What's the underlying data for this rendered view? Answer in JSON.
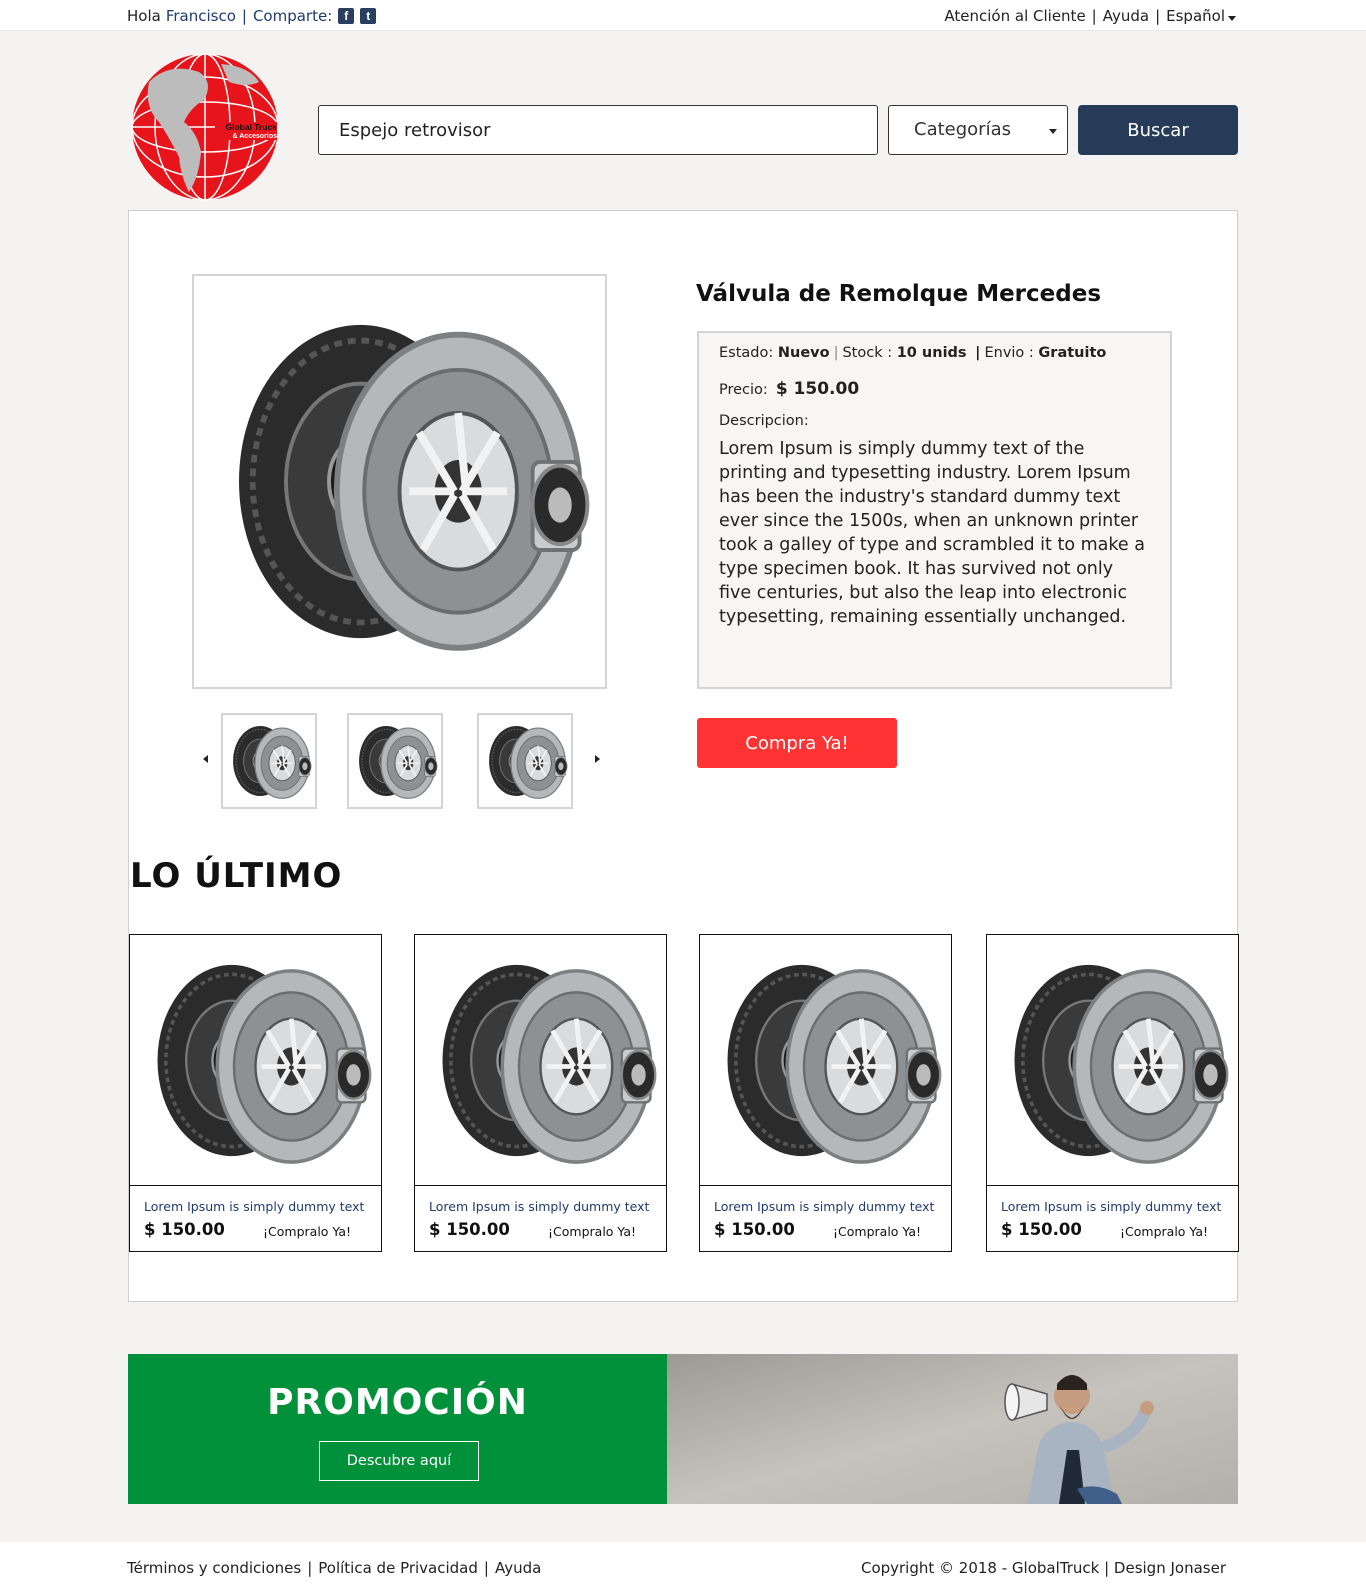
{
  "topbar": {
    "greeting": "Hola",
    "user_name": "Francisco",
    "share_label": "Comparte:",
    "social_icons": [
      "facebook-icon",
      "twitter-icon"
    ],
    "customer_service": "Atención al Cliente",
    "help": "Ayuda",
    "language": "Español"
  },
  "header": {
    "logo_text_line1": "Global Truck",
    "logo_text_line2": "& Accesorios",
    "search_value": "Espejo retrovisor",
    "category_label": "Categorías",
    "search_button": "Buscar"
  },
  "product": {
    "title": "Válvula de Remolque Mercedes",
    "state_label": "Estado:",
    "state_value": "Nuevo",
    "stock_label": "Stock :",
    "stock_value": "10 unids",
    "shipping_label": "Envio :",
    "shipping_value": "Gratuito",
    "price_label": "Precio:",
    "price_value": "$ 150.00",
    "description_label": "Descripcion:",
    "description": "Lorem Ipsum is simply dummy text of the printing and typesetting industry. Lorem Ipsum has been the industry's standard dummy text ever since the 1500s, when an unknown printer took a galley of type and scrambled it to make a type specimen book. It has survived not only five centuries, but also the leap into electronic typesetting, remaining essentially unchanged.",
    "buy_button": "Compra Ya!"
  },
  "latest": {
    "title": "LO ÚLTIMO",
    "cards": [
      {
        "text": "Lorem Ipsum is simply dummy text",
        "price": "$ 150.00",
        "cta": "¡Compralo Ya!"
      },
      {
        "text": "Lorem Ipsum is simply dummy text",
        "price": "$ 150.00",
        "cta": "¡Compralo Ya!"
      },
      {
        "text": "Lorem Ipsum is simply dummy text",
        "price": "$ 150.00",
        "cta": "¡Compralo Ya!"
      },
      {
        "text": "Lorem Ipsum is simply dummy text",
        "price": "$ 150.00",
        "cta": "¡Compralo Ya!"
      }
    ]
  },
  "promo": {
    "title": "PROMOCIÓN",
    "button": "Descubre aquí"
  },
  "footer": {
    "terms": "Términos y condiciones",
    "privacy": "Política de Privacidad",
    "help": "Ayuda",
    "copyright": "Copyright © 2018 - GlobalTruck | Design Jonaser"
  },
  "colors": {
    "brand_dark": "#263b57",
    "buy_red": "#ff3333",
    "promo_green": "#00913a",
    "link_blue": "#1f3b6e"
  }
}
